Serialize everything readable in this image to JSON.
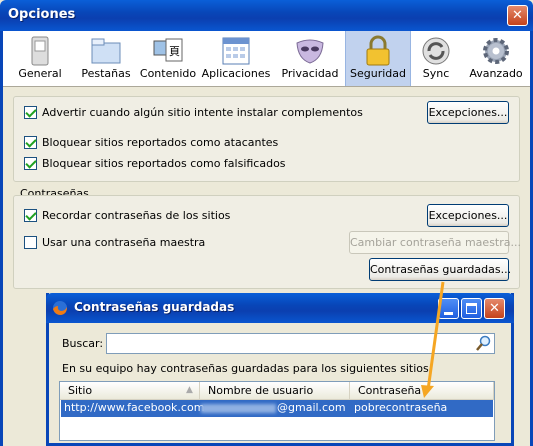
{
  "window": {
    "title": "Opciones",
    "close_glyph": "✕"
  },
  "toolbar": {
    "tabs": [
      {
        "label": "General",
        "icon": "switch-icon"
      },
      {
        "label": "Pestañas",
        "icon": "folder-tabs-icon"
      },
      {
        "label": "Contenido",
        "icon": "content-icon"
      },
      {
        "label": "Aplicaciones",
        "icon": "applications-icon"
      },
      {
        "label": "Privacidad",
        "icon": "mask-icon"
      },
      {
        "label": "Seguridad",
        "icon": "padlock-icon",
        "selected": true
      },
      {
        "label": "Sync",
        "icon": "sync-icon"
      },
      {
        "label": "Avanzado",
        "icon": "gear-icon"
      }
    ]
  },
  "security": {
    "warn_addons": {
      "label": "Advertir cuando algún sitio intente instalar complementos",
      "checked": true
    },
    "block_attack": {
      "label": "Bloquear sitios reportados como atacantes",
      "checked": true
    },
    "block_forgery": {
      "label": "Bloquear sitios reportados como falsificados",
      "checked": true
    },
    "exceptions_label": "Excepciones..."
  },
  "passwords": {
    "group_label": "Contraseñas",
    "remember": {
      "label": "Recordar contraseñas de los sitios",
      "checked": true
    },
    "master": {
      "label": "Usar una contraseña maestra",
      "checked": false
    },
    "exceptions_label": "Excepciones...",
    "change_master_label": "Cambiar contraseña maestra...",
    "saved_label": "Contraseñas guardadas..."
  },
  "dialog": {
    "title": "Contraseñas guardadas",
    "search_label": "Buscar:",
    "search_value": "",
    "description": "En su equipo hay contraseñas guardadas para los siguientes sitios:",
    "columns": [
      "Sitio",
      "Nombre de usuario",
      "Contraseña"
    ],
    "rows": [
      {
        "site": "http://www.facebook.com",
        "user_visible": "@gmail.com",
        "password": "pobrecontraseña"
      }
    ]
  },
  "colors": {
    "title_blue": "#0846b8",
    "selection": "#316ac5",
    "arrow": "#f5a623"
  }
}
